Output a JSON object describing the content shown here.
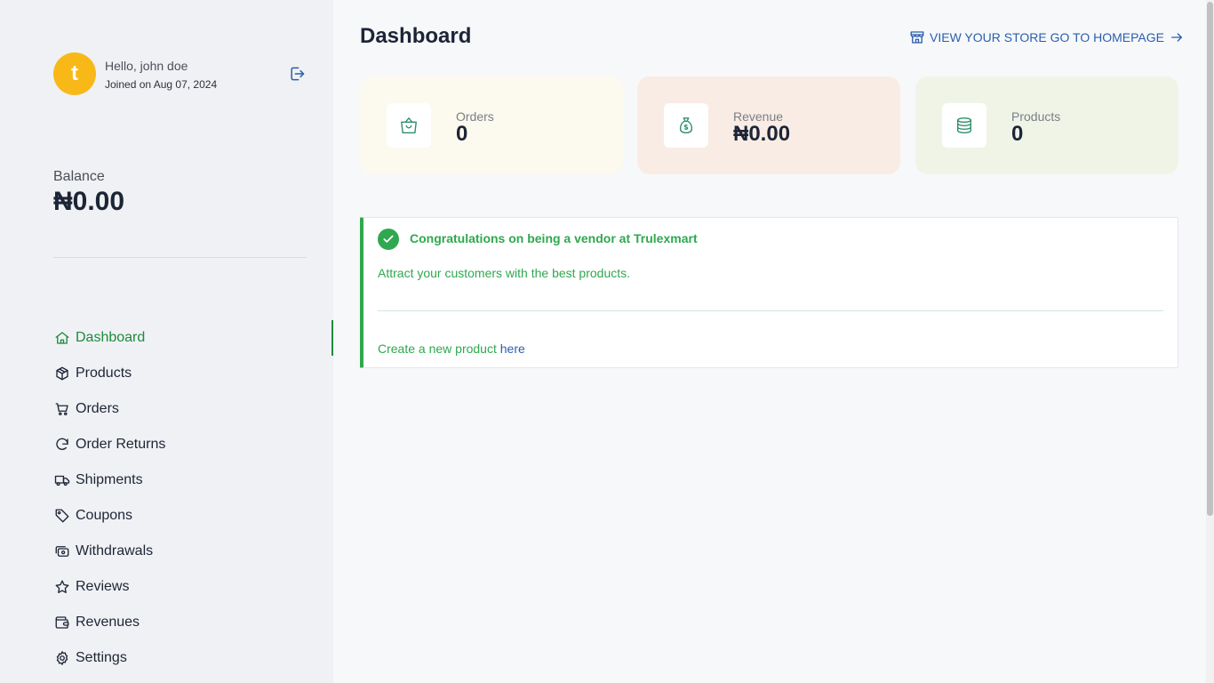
{
  "user": {
    "avatar_letter": "t",
    "greeting": "Hello, john doe",
    "joined": "Joined on Aug 07, 2024"
  },
  "balance": {
    "label": "Balance",
    "value": "₦0.00"
  },
  "nav": [
    {
      "label": "Dashboard",
      "icon": "home-icon",
      "active": true
    },
    {
      "label": "Products",
      "icon": "box-icon"
    },
    {
      "label": "Orders",
      "icon": "cart-icon"
    },
    {
      "label": "Order Returns",
      "icon": "refresh-icon"
    },
    {
      "label": "Shipments",
      "icon": "truck-icon"
    },
    {
      "label": "Coupons",
      "icon": "tag-icon"
    },
    {
      "label": "Withdrawals",
      "icon": "cash-icon"
    },
    {
      "label": "Reviews",
      "icon": "star-icon"
    },
    {
      "label": "Revenues",
      "icon": "wallet-icon"
    },
    {
      "label": "Settings",
      "icon": "gear-icon"
    }
  ],
  "page": {
    "title": "Dashboard",
    "store_link": "VIEW YOUR STORE GO TO HOMEPAGE"
  },
  "stats": [
    {
      "label": "Orders",
      "value": "0",
      "icon": "shopping-bag-icon",
      "bg": "#fcf9ee"
    },
    {
      "label": "Revenue",
      "value": "₦0.00",
      "icon": "money-bag-icon",
      "bg": "#f9ece4"
    },
    {
      "label": "Products",
      "value": "0",
      "icon": "database-icon",
      "bg": "#f0f4e7"
    }
  ],
  "notice": {
    "heading": "Congratulations on being a vendor at Trulexmart",
    "message": "Attract your customers with the best products.",
    "create_prefix": "Create a new product ",
    "create_link": "here"
  },
  "colors": {
    "accent_green": "#2fa84f",
    "nav_active": "#1b8c3c",
    "link_blue": "#2a5fae",
    "avatar": "#f8b817"
  }
}
